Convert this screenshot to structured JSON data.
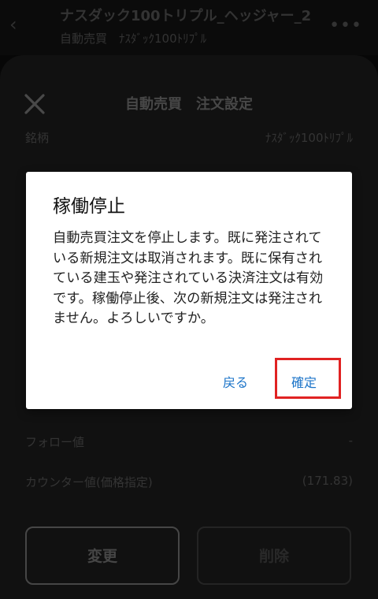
{
  "header": {
    "title": "ナスダック100トリプル_ヘッジャー_2",
    "subtitle": "自動売買　ﾅｽﾀﾞｯｸ100ﾄﾘﾌﾟﾙ",
    "back_icon": "‹",
    "more_icon": "•••"
  },
  "sheet": {
    "title": "自動売買　注文設定",
    "rows": {
      "symbol": {
        "label": "銘柄",
        "value": "ﾅｽﾀﾞｯｸ100ﾄﾘﾌﾟﾙ"
      },
      "follow": {
        "label": "フォロー値",
        "value": "-"
      },
      "counter": {
        "label": "カウンター値(価格指定)",
        "value": "(171.83)"
      }
    },
    "buttons": {
      "change": "変更",
      "delete": "削除"
    }
  },
  "dialog": {
    "title": "稼働停止",
    "message": "自動売買注文を停止します。既に発注されている新規注文は取消されます。既に保有されている建玉や発注されている決済注文は有効です。稼働停止後、次の新規注文は発注されません。よろしいですか。",
    "back_label": "戻る",
    "confirm_label": "確定"
  },
  "colors": {
    "link": "#1a73c8",
    "highlight": "#e02222"
  }
}
